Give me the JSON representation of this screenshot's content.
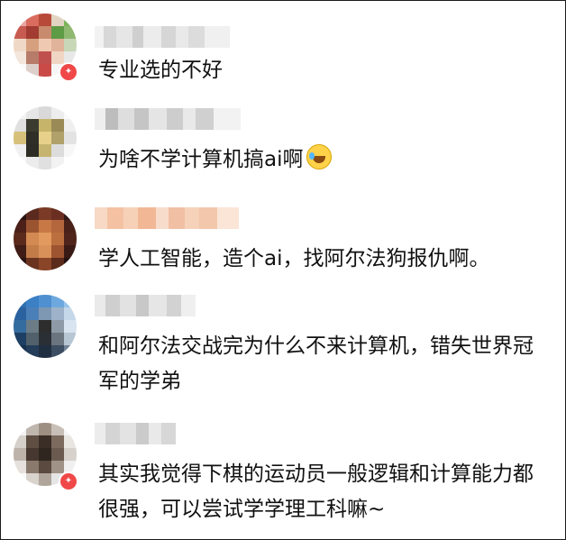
{
  "comments": [
    {
      "text": "专业选的不好",
      "emoji": ""
    },
    {
      "text": "为啥不学计算机搞ai啊",
      "emoji": "laughing-tears"
    },
    {
      "text": "学人工智能，造个ai，找阿尔法狗报仇啊。",
      "emoji": ""
    },
    {
      "text": "和阿尔法交战完为什么不来计算机，错失世界冠军的学弟",
      "emoji": ""
    },
    {
      "text": "其实我觉得下棋的运动员一般逻辑和计算能力都很强，可以尝试学学理工科嘛~",
      "emoji": ""
    }
  ]
}
